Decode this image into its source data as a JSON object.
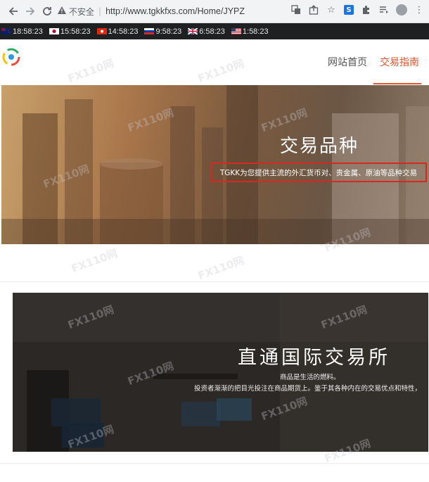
{
  "browser": {
    "insecure_label": "不安全",
    "url": "http://www.tgkkfxs.com/Home/JYPZ",
    "icons": [
      "back-icon",
      "forward-icon",
      "reload-icon",
      "warning-icon",
      "translate-icon",
      "share-icon",
      "star-icon",
      "extension-s-icon",
      "puzzle-icon",
      "reading-list-icon",
      "profile-icon",
      "menu-icon"
    ]
  },
  "clocks": [
    {
      "flag": "nz",
      "time": "18:58:23"
    },
    {
      "flag": "jp",
      "time": "15:58:23"
    },
    {
      "flag": "hk",
      "time": "14:58:23"
    },
    {
      "flag": "ru",
      "time": "9:58:23"
    },
    {
      "flag": "gb",
      "time": "6:58:23"
    },
    {
      "flag": "us",
      "time": "1:58:23"
    }
  ],
  "nav": {
    "home": "网站首页",
    "guide": "交易指南"
  },
  "hero1": {
    "title": "交易品种",
    "subtitle": "TGKK为您提供主流的外汇货币对、贵金属、原油等品种交易"
  },
  "hero2": {
    "title": "直通国际交易所",
    "line1": "商品是生活的燃料。",
    "line2": "投资者渐渐的把目光投注在商品期货上。鉴于其各种内在的交易优点和特性，"
  },
  "watermark_text": "FX110网",
  "colors": {
    "accent": "#e4572e",
    "highlight_box": "#d9281f",
    "clockbar": "#1f2022"
  }
}
